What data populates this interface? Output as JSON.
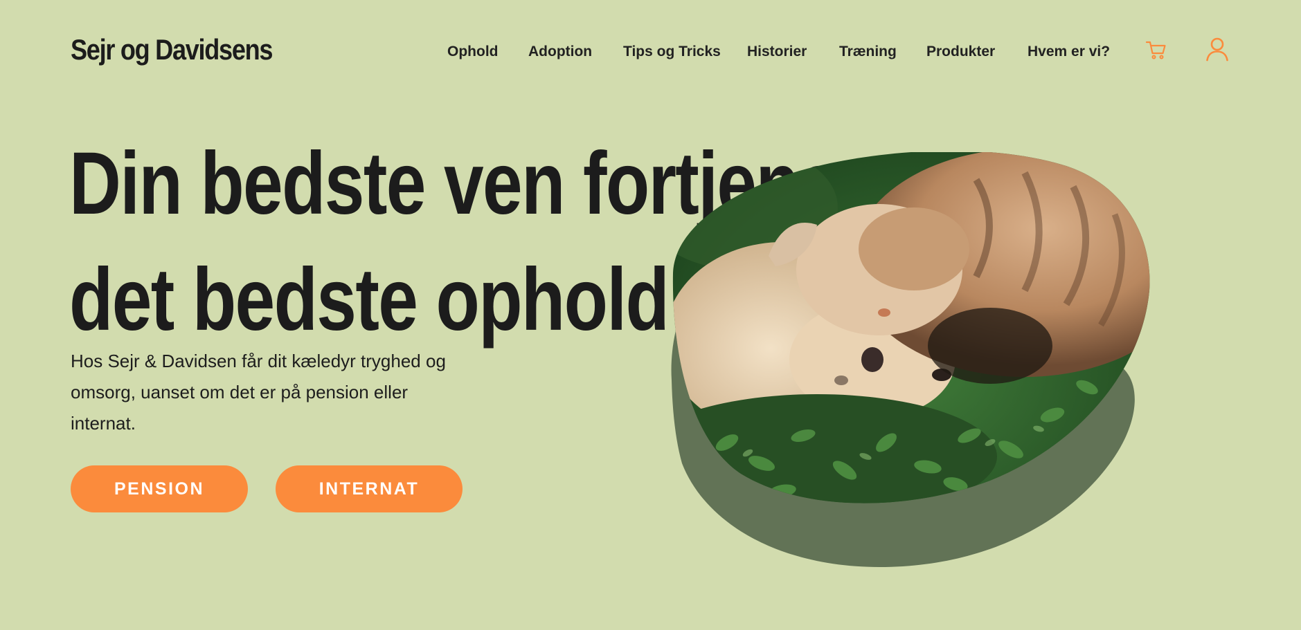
{
  "header": {
    "logo": "Sejr og Davidsens",
    "nav": [
      {
        "label": "Ophold"
      },
      {
        "label": "Adoption"
      },
      {
        "label": "Tips og Tricks"
      },
      {
        "label": "Historier"
      },
      {
        "label": "Træning"
      },
      {
        "label": "Produkter"
      },
      {
        "label": "Hvem er vi?"
      }
    ],
    "icons": {
      "cart": "cart-icon",
      "user": "user-icon"
    }
  },
  "hero": {
    "headline_line1": "Din bedste ven fortjener",
    "headline_line2": "det bedste ophold",
    "subtext": "Hos Sejr & Davidsen får dit kæledyr tryghed og omsorg, uanset om det er på pension eller internat.",
    "buttons": {
      "pension": "PENSION",
      "internat": "INTERNAT"
    }
  },
  "colors": {
    "background": "#d2dcae",
    "accent": "#fb8b3c",
    "blob_shadow": "#627356",
    "text": "#1c1c1c"
  }
}
